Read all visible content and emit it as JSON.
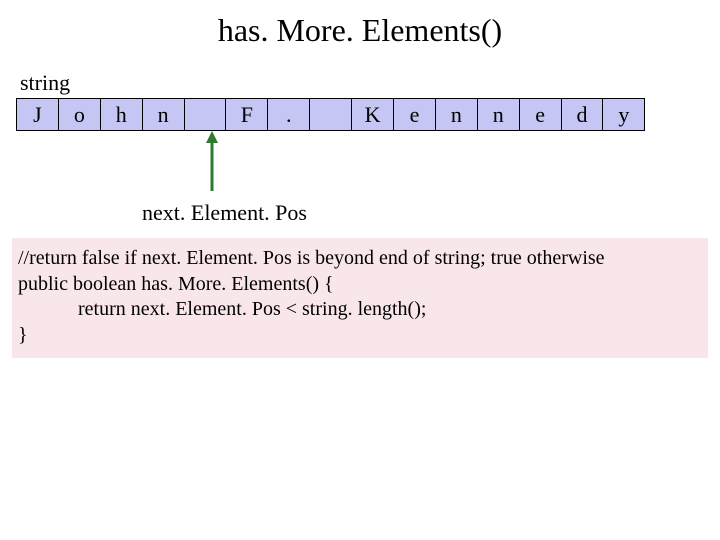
{
  "title": "has. More. Elements()",
  "stringLabel": "string",
  "cells": [
    "J",
    "o",
    "h",
    "n",
    "",
    "F",
    ".",
    "",
    "K",
    "e",
    "n",
    "n",
    "e",
    "d",
    "y"
  ],
  "arrowTargetIndex": 4,
  "nepLabel": "next. Element. Pos",
  "code": {
    "l1": "//return false if next. Element. Pos is beyond end of string; true otherwise",
    "l2": "public boolean has. More. Elements() {",
    "l3": "            return next. Element. Pos < string. length();",
    "l4": "}"
  },
  "colors": {
    "cellFill": "#c6c6f5",
    "codeBg": "#f9e6eb",
    "arrow": "#2f7a2f"
  }
}
